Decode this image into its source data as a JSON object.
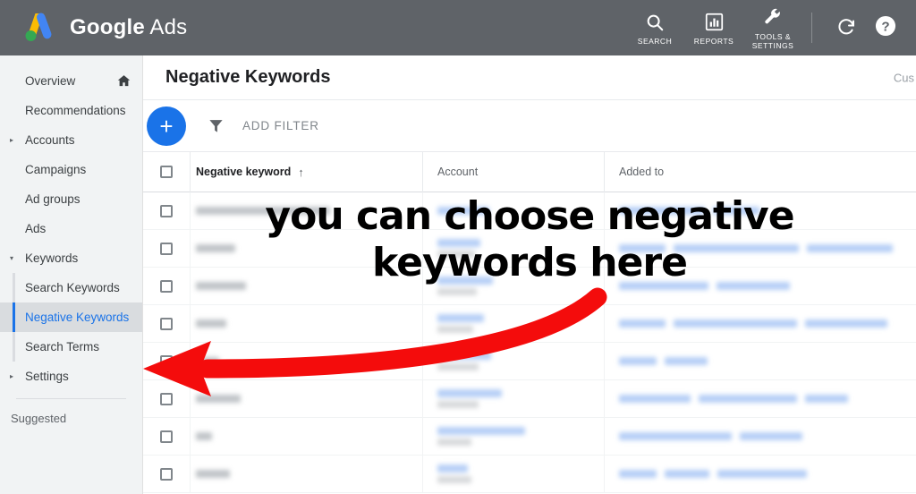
{
  "topbar": {
    "brand_google": "Google",
    "brand_ads": "Ads",
    "actions": [
      {
        "label": "SEARCH",
        "icon": "search-icon"
      },
      {
        "label": "REPORTS",
        "icon": "bar-chart-icon"
      },
      {
        "label": "TOOLS &\nSETTINGS",
        "label_line1": "TOOLS &",
        "label_line2": "SETTINGS",
        "icon": "wrench-icon"
      }
    ],
    "refresh_icon": "refresh-icon",
    "help_icon": "help-icon",
    "background_color": "#5f6368"
  },
  "sidebar": {
    "items": [
      {
        "label": "Overview",
        "level": 0,
        "caret": "",
        "trailing_icon": "home-icon",
        "active": false
      },
      {
        "label": "Recommendations",
        "level": 0,
        "caret": "",
        "trailing_icon": "",
        "active": false
      },
      {
        "label": "Accounts",
        "level": 0,
        "caret": "▸",
        "trailing_icon": "",
        "active": false
      },
      {
        "label": "Campaigns",
        "level": 0,
        "caret": "",
        "trailing_icon": "",
        "active": false
      },
      {
        "label": "Ad groups",
        "level": 0,
        "caret": "",
        "trailing_icon": "",
        "active": false
      },
      {
        "label": "Ads",
        "level": 0,
        "caret": "",
        "trailing_icon": "",
        "active": false
      },
      {
        "label": "Keywords",
        "level": 0,
        "caret": "▾",
        "trailing_icon": "",
        "active": false
      }
    ],
    "sub_items": [
      {
        "label": "Search Keywords",
        "active": false
      },
      {
        "label": "Negative Keywords",
        "active": true
      },
      {
        "label": "Search Terms",
        "active": false
      }
    ],
    "settings": {
      "label": "Settings",
      "caret": "▸"
    },
    "suggested_label": "Suggested",
    "active_color": "#1a73e8",
    "background_color": "#f1f3f4"
  },
  "page": {
    "title": "Negative Keywords",
    "customize_label": "Cus"
  },
  "toolbar": {
    "add_button_icon": "plus-icon",
    "filter_icon": "filter-icon",
    "add_filter_label": "ADD FILTER",
    "accent_color": "#1a73e8"
  },
  "table": {
    "select_all_checkbox": "select-all-checkbox",
    "columns": [
      {
        "key": "keyword",
        "label": "Negative keyword",
        "sort": "↑"
      },
      {
        "key": "account",
        "label": "Account",
        "sort": ""
      },
      {
        "key": "added_to",
        "label": "Added to",
        "sort": ""
      }
    ],
    "rows": [
      {
        "keyword_w": 150,
        "account_w": 58,
        "account_sub_w": 0,
        "chips": [
          96,
          52
        ]
      },
      {
        "keyword_w": 44,
        "account_w": 48,
        "account_sub_w": 42,
        "chips": [
          52,
          140,
          96
        ]
      },
      {
        "keyword_w": 56,
        "account_w": 62,
        "account_sub_w": 44,
        "chips": [
          100,
          82
        ]
      },
      {
        "keyword_w": 34,
        "account_w": 52,
        "account_sub_w": 40,
        "chips": [
          52,
          138,
          92
        ]
      },
      {
        "keyword_w": 26,
        "account_w": 60,
        "account_sub_w": 46,
        "chips": [
          42,
          48
        ]
      },
      {
        "keyword_w": 50,
        "account_w": 72,
        "account_sub_w": 46,
        "chips": [
          80,
          110,
          48
        ]
      },
      {
        "keyword_w": 18,
        "account_w": 98,
        "account_sub_w": 38,
        "chips": [
          126,
          70
        ]
      },
      {
        "keyword_w": 38,
        "account_w": 34,
        "account_sub_w": 38,
        "chips": [
          42,
          50,
          100
        ]
      }
    ]
  },
  "annotation": {
    "line1": "you can choose negative",
    "line2": "keywords here",
    "arrow_color": "#f40c0c",
    "text_color": "#000000"
  }
}
